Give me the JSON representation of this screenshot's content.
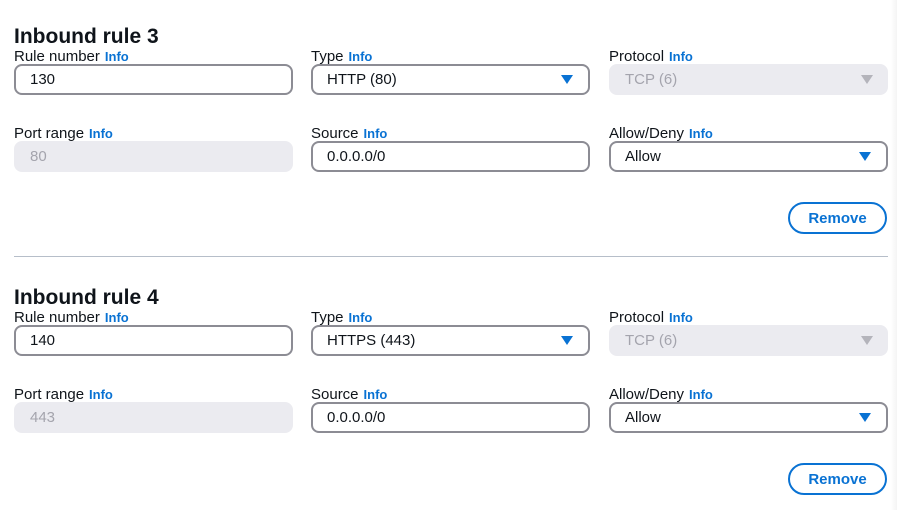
{
  "rules": [
    {
      "title": "Inbound rule 3",
      "rule_number": {
        "label": "Rule number",
        "info": "Info",
        "value": "130"
      },
      "type": {
        "label": "Type",
        "info": "Info",
        "value": "HTTP (80)"
      },
      "protocol": {
        "label": "Protocol",
        "info": "Info",
        "value": "TCP (6)"
      },
      "port_range": {
        "label": "Port range",
        "info": "Info",
        "value": "80"
      },
      "source": {
        "label": "Source",
        "info": "Info",
        "value": "0.0.0.0/0"
      },
      "allow_deny": {
        "label": "Allow/Deny",
        "info": "Info",
        "value": "Allow"
      },
      "remove_label": "Remove"
    },
    {
      "title": "Inbound rule 4",
      "rule_number": {
        "label": "Rule number",
        "info": "Info",
        "value": "140"
      },
      "type": {
        "label": "Type",
        "info": "Info",
        "value": "HTTPS (443)"
      },
      "protocol": {
        "label": "Protocol",
        "info": "Info",
        "value": "TCP (6)"
      },
      "port_range": {
        "label": "Port range",
        "info": "Info",
        "value": "443"
      },
      "source": {
        "label": "Source",
        "info": "Info",
        "value": "0.0.0.0/0"
      },
      "allow_deny": {
        "label": "Allow/Deny",
        "info": "Info",
        "value": "Allow"
      },
      "remove_label": "Remove"
    }
  ],
  "colors": {
    "link": "#0972d3",
    "border": "#8c8c94",
    "disabled_bg": "#ebebf0",
    "disabled_text": "#a4a4ad",
    "divider": "#b6bec9"
  },
  "icons": {
    "dropdown": "caret-down-icon"
  }
}
